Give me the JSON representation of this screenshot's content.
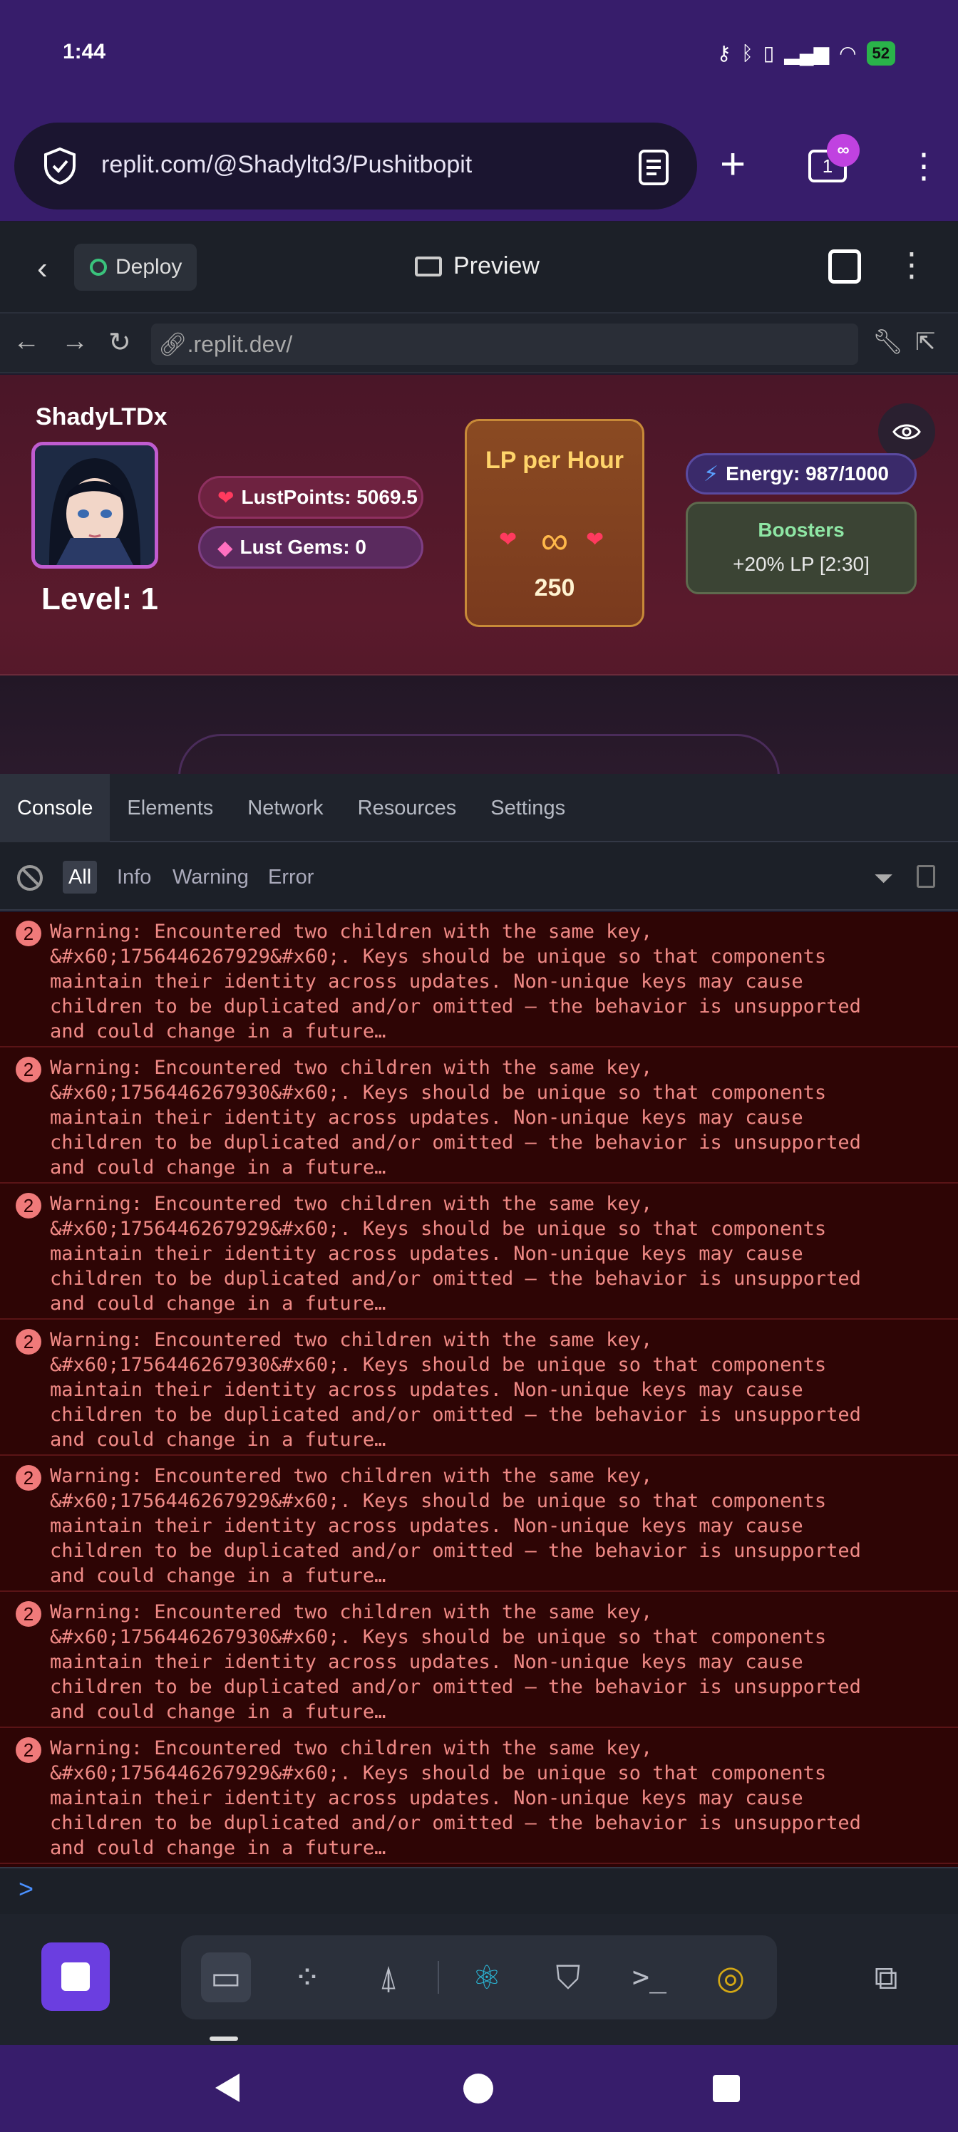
{
  "status_bar": {
    "time": "1:44",
    "battery": "52"
  },
  "browser": {
    "url": "replit.com/@Shadyltd3/Pushitbopit",
    "tab_count": "1",
    "tab_badge": "∞"
  },
  "replit_header": {
    "deploy_label": "Deploy",
    "preview_label": "Preview"
  },
  "webview": {
    "address": ".replit.dev/"
  },
  "game": {
    "player_name": "ShadyLTDx",
    "level": "Level: 1",
    "lust_points": "LustPoints: 5069.5",
    "lust_gems": "Lust Gems: 0",
    "lp_card_title": "LP per Hour",
    "lp_infinity": "∞",
    "lp_per_hour": "250",
    "energy": "Energy: 987/1000",
    "boosters_title": "Boosters",
    "boosters_detail": "+20% LP [2:30]"
  },
  "devtools": {
    "tabs": [
      "Console",
      "Elements",
      "Network",
      "Resources",
      "Settings"
    ],
    "active_tab": "Console",
    "filters": [
      "All",
      "Info",
      "Warning",
      "Error"
    ],
    "active_filter": "All",
    "logs": [
      {
        "count": "2",
        "text": "Warning: Encountered two children with the same key,\n&#x60;1756446267929&#x60;. Keys should be unique so that components\nmaintain their identity across updates. Non-unique keys may cause\nchildren to be duplicated and/or omitted — the behavior is unsupported\nand could change in a future…"
      },
      {
        "count": "2",
        "text": "Warning: Encountered two children with the same key,\n&#x60;1756446267930&#x60;. Keys should be unique so that components\nmaintain their identity across updates. Non-unique keys may cause\nchildren to be duplicated and/or omitted — the behavior is unsupported\nand could change in a future…"
      },
      {
        "count": "2",
        "text": "Warning: Encountered two children with the same key,\n&#x60;1756446267929&#x60;. Keys should be unique so that components\nmaintain their identity across updates. Non-unique keys may cause\nchildren to be duplicated and/or omitted — the behavior is unsupported\nand could change in a future…"
      },
      {
        "count": "2",
        "text": "Warning: Encountered two children with the same key,\n&#x60;1756446267930&#x60;. Keys should be unique so that components\nmaintain their identity across updates. Non-unique keys may cause\nchildren to be duplicated and/or omitted — the behavior is unsupported\nand could change in a future…"
      },
      {
        "count": "2",
        "text": "Warning: Encountered two children with the same key,\n&#x60;1756446267929&#x60;. Keys should be unique so that components\nmaintain their identity across updates. Non-unique keys may cause\nchildren to be duplicated and/or omitted — the behavior is unsupported\nand could change in a future…"
      },
      {
        "count": "2",
        "text": "Warning: Encountered two children with the same key,\n&#x60;1756446267930&#x60;. Keys should be unique so that components\nmaintain their identity across updates. Non-unique keys may cause\nchildren to be duplicated and/or omitted — the behavior is unsupported\nand could change in a future…"
      },
      {
        "count": "2",
        "text": "Warning: Encountered two children with the same key,\n&#x60;1756446267929&#x60;. Keys should be unique so that components\nmaintain their identity across updates. Non-unique keys may cause\nchildren to be duplicated and/or omitted — the behavior is unsupported\nand could change in a future…"
      }
    ],
    "prompt": ">"
  },
  "toolbar": {
    "icons": [
      "preview-icon",
      "apps-icon",
      "deploy-icon",
      "react-icon",
      "security-icon",
      "shell-icon",
      "ai-icon"
    ]
  },
  "colors": {
    "accent": "#6b3ee0",
    "system_bar": "#371d6b",
    "warning_text": "#f08a86"
  }
}
